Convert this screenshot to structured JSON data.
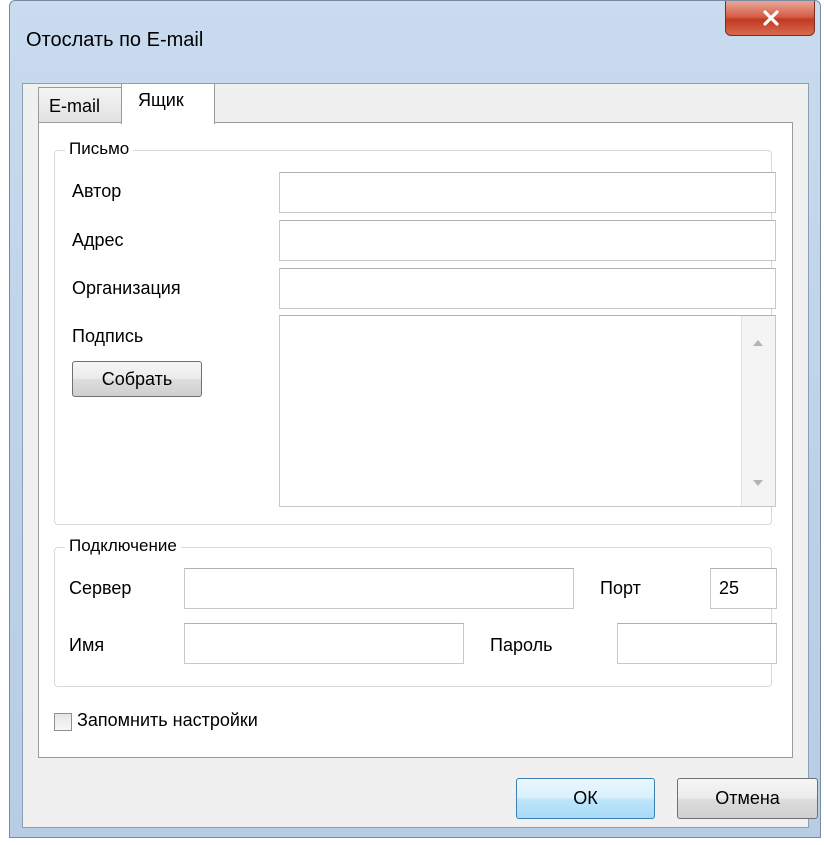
{
  "window": {
    "title": "Отослать по E-mail"
  },
  "tabs": [
    {
      "label": "E-mail",
      "active": false
    },
    {
      "label": "Ящик",
      "active": true
    }
  ],
  "letter": {
    "group_title": "Письмо",
    "author_label": "Автор",
    "author_value": "",
    "address_label": "Адрес",
    "address_value": "",
    "organization_label": "Организация",
    "organization_value": "",
    "signature_label": "Подпись",
    "signature_value": "",
    "collect_button": "Собрать"
  },
  "connection": {
    "group_title": "Подключение",
    "server_label": "Сервер",
    "server_value": "",
    "port_label": "Порт",
    "port_value": "25",
    "name_label": "Имя",
    "name_value": "",
    "password_label": "Пароль",
    "password_value": ""
  },
  "remember": {
    "label": "Запомнить настройки",
    "checked": false
  },
  "buttons": {
    "ok": "ОК",
    "cancel": "Отмена"
  },
  "colors": {
    "frame": "#bcd1e8",
    "close_button": "#c03a22",
    "default_button_border": "#3c7fb1"
  },
  "icons": [
    "close-icon",
    "scroll-up-icon",
    "scroll-down-icon",
    "checkbox"
  ]
}
